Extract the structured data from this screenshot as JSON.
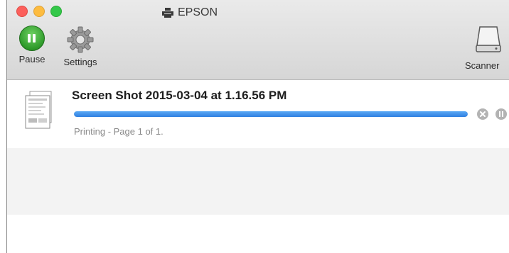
{
  "window": {
    "title": "EPSON",
    "colors": {
      "toolbar": "#dcdcdc",
      "pause_green": "#2e9a2a",
      "progress_blue": "#2f7fe0",
      "close": "#fc605c",
      "minimize": "#fdbc40",
      "maximize": "#34c84a"
    }
  },
  "toolbar": {
    "pause_label": "Pause",
    "pause_icon": "pause-circle-icon",
    "settings_label": "Settings",
    "settings_icon": "gear-icon",
    "scanner_label": "Scanner",
    "scanner_icon": "scanner-icon"
  },
  "jobs": [
    {
      "name": "Screen Shot 2015-03-04 at 1.16.56 PM",
      "status": "Printing - Page 1 of 1.",
      "progress": 1.0,
      "thumbnail_icon": "document-thumbnail-icon",
      "cancel_icon": "cancel-icon",
      "hold_icon": "pause-job-icon"
    }
  ]
}
